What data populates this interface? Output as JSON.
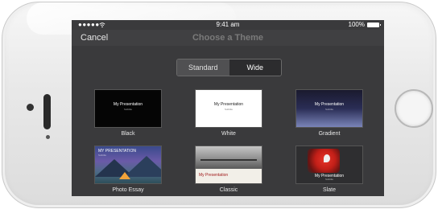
{
  "status_bar": {
    "signal": "●●●●●",
    "time": "9:41 am",
    "battery": "100%"
  },
  "nav": {
    "cancel_label": "Cancel",
    "title": "Choose a Theme"
  },
  "segmented_control": {
    "options": [
      "Standard",
      "Wide"
    ],
    "selected": "Wide"
  },
  "themes": [
    {
      "name": "Black",
      "thumb_title": "My Presentation",
      "thumb_subtitle": "Subtitle"
    },
    {
      "name": "White",
      "thumb_title": "My Presentation",
      "thumb_subtitle": "Subtitle"
    },
    {
      "name": "Gradient",
      "thumb_title": "My Presentation",
      "thumb_subtitle": "Subtitle"
    },
    {
      "name": "Photo Essay",
      "thumb_title": "MY PRESENTATION",
      "thumb_subtitle": "Subtitle"
    },
    {
      "name": "Classic",
      "thumb_title": "My Presentation",
      "thumb_subtitle": ""
    },
    {
      "name": "Slate",
      "thumb_title": "My Presentation",
      "thumb_subtitle": "Subtitle"
    }
  ],
  "colors": {
    "screen_bg": "#3a3a3c",
    "nav_bg": "#404042",
    "phone_body": "#e9e9e9"
  }
}
